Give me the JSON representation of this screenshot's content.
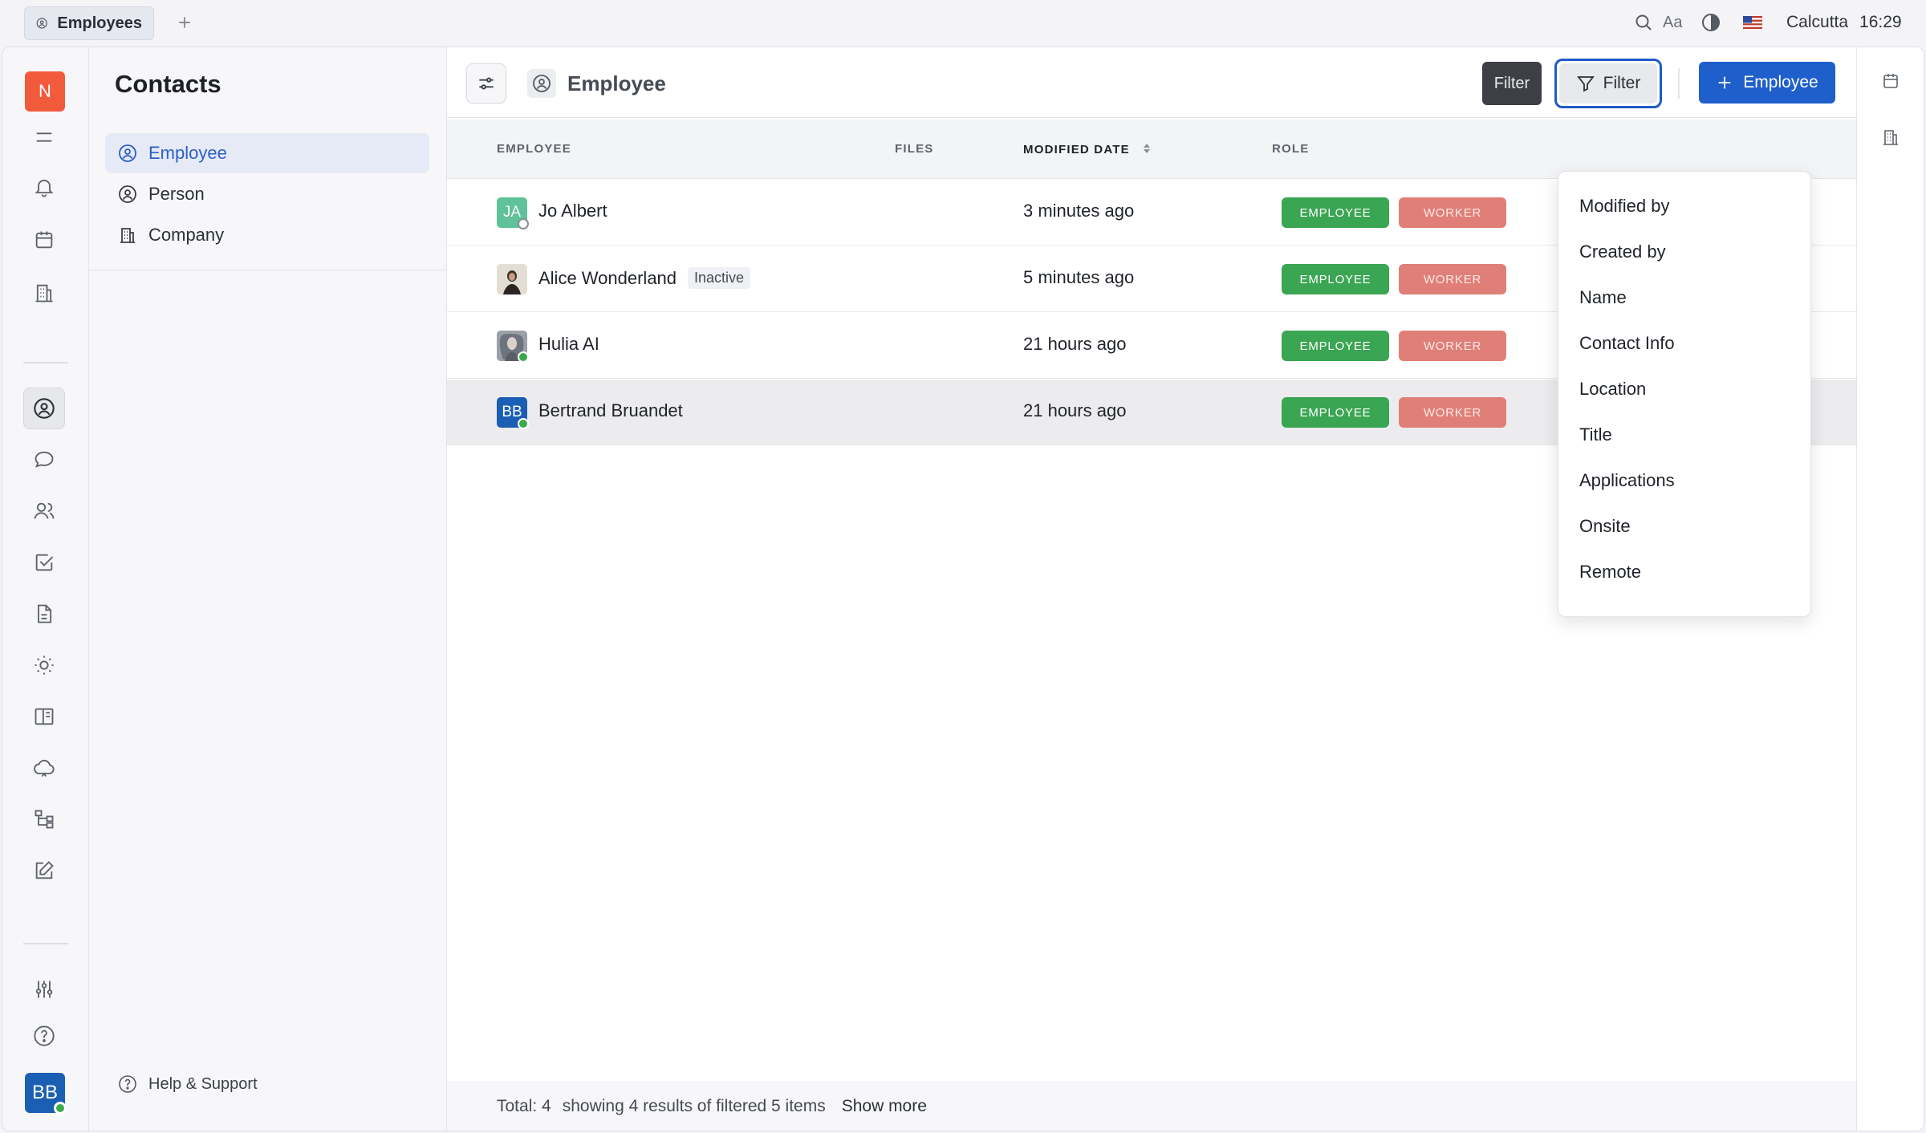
{
  "tabbar": {
    "tab_label": "Employees"
  },
  "topbar": {
    "font_label": "Aa",
    "location": "Calcutta",
    "time": "16:29"
  },
  "workspace": {
    "initial": "N"
  },
  "user": {
    "initials": "BB"
  },
  "navigator": {
    "title": "Contacts",
    "items": [
      {
        "label": "Employee",
        "icon": "person-circle-icon",
        "active": true
      },
      {
        "label": "Person",
        "icon": "person-circle-icon",
        "active": false
      },
      {
        "label": "Company",
        "icon": "building-icon",
        "active": false
      }
    ],
    "help_label": "Help & Support"
  },
  "main": {
    "title": "Employee",
    "filter_tooltip": "Filter",
    "filter_label": "Filter",
    "add_label": "Employee"
  },
  "table": {
    "headers": {
      "employee": "EMPLOYEE",
      "files": "FILES",
      "modified": "MODIFIED DATE",
      "role": "ROLE"
    },
    "rows": [
      {
        "initials": "JA",
        "name": "Jo Albert",
        "badge": "",
        "modified": "3 minutes ago",
        "role1": "EMPLOYEE",
        "role2": "WORKER",
        "avatar_color": "#5fc29a",
        "status": "offline"
      },
      {
        "initials": "",
        "name": "Alice Wonderland",
        "badge": "Inactive",
        "modified": "5 minutes ago",
        "role1": "EMPLOYEE",
        "role2": "WORKER",
        "avatar_color": "#d9d2c8",
        "status": "none"
      },
      {
        "initials": "",
        "name": "Hulia AI",
        "badge": "",
        "modified": "21 hours ago",
        "role1": "EMPLOYEE",
        "role2": "WORKER",
        "avatar_color": "#8a8f97",
        "status": "online"
      },
      {
        "initials": "BB",
        "name": "Bertrand Bruandet",
        "badge": "",
        "modified": "21 hours ago",
        "role1": "EMPLOYEE",
        "role2": "WORKER",
        "avatar_color": "#1a5fb4",
        "status": "online"
      }
    ]
  },
  "footer": {
    "total": "Total: 4",
    "showing": "showing 4 results of filtered 5 items",
    "show_more": "Show more"
  },
  "filter_menu": {
    "items": [
      "Modified by",
      "Created by",
      "Name",
      "Contact Info",
      "Location",
      "Title",
      "Applications",
      "Onsite",
      "Remote"
    ]
  },
  "colors": {
    "accent": "#1f5fcb",
    "employee_badge": "#3aa552",
    "worker_badge": "#e07f77",
    "workspace_badge": "#f25a3c"
  }
}
